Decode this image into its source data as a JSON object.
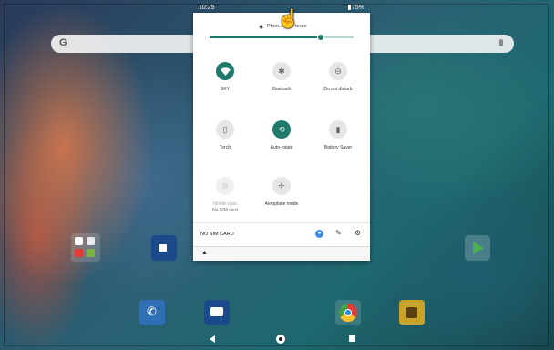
{
  "status_bar": {
    "time": "10:25",
    "battery": "75%"
  },
  "quick_settings": {
    "header_text": "Phon... ... ... brate",
    "brightness_level": 0.77,
    "tiles": [
      {
        "id": "wifi",
        "label": "SKY",
        "icon": "wifi-icon",
        "active": true
      },
      {
        "id": "bluetooth",
        "label": "Bluetooth",
        "icon": "bluetooth-icon",
        "active": false
      },
      {
        "id": "dnd",
        "label": "Do not disturb",
        "icon": "dnd-icon",
        "active": false
      },
      {
        "id": "torch",
        "label": "Torch",
        "icon": "torch-icon",
        "active": false
      },
      {
        "id": "autorotate",
        "label": "Auto-rotate",
        "icon": "autorotate-icon",
        "active": true
      },
      {
        "id": "battery-saver",
        "label": "Battery Saver",
        "icon": "battery-saver-icon",
        "active": false
      },
      {
        "id": "mobile-data",
        "label": "Mobile data",
        "sublabel": "No SIM card",
        "icon": "mobile-data-icon",
        "active": false
      },
      {
        "id": "aeroplane",
        "label": "Aeroplane mode",
        "icon": "aeroplane-icon",
        "active": false
      }
    ],
    "footer": {
      "sim_status": "NO SIM CARD"
    }
  },
  "colors": {
    "accent": "#1f7a6d",
    "panel": "#ffffff"
  }
}
